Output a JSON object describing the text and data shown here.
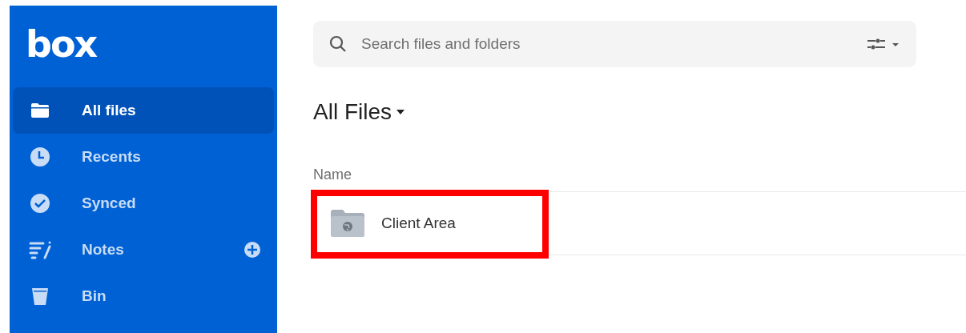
{
  "sidebar": {
    "logo": "box",
    "items": [
      {
        "label": "All files",
        "selected": true
      },
      {
        "label": "Recents",
        "selected": false
      },
      {
        "label": "Synced",
        "selected": false
      },
      {
        "label": "Notes",
        "selected": false,
        "add_button": true
      },
      {
        "label": "Bin",
        "selected": false
      }
    ]
  },
  "search": {
    "placeholder": "Search files and folders"
  },
  "title": "All Files",
  "table": {
    "columns": [
      "Name"
    ],
    "rows": [
      {
        "name": "Client Area",
        "highlighted": true
      }
    ]
  }
}
